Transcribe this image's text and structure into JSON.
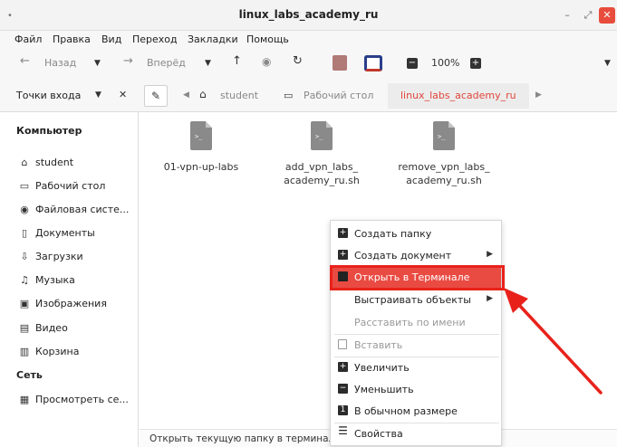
{
  "window": {
    "title": "linux_labs_academy_ru",
    "minimize": "–",
    "maximize": "⤢",
    "close": "✕"
  },
  "menubar": [
    "Файл",
    "Правка",
    "Вид",
    "Переход",
    "Закладки",
    "Помощь"
  ],
  "toolbar": {
    "back": "Назад",
    "forward": "Вперёд",
    "zoom": "100%"
  },
  "location": {
    "places_label": "Точки входа",
    "crumbs": [
      "student",
      "Рабочий стол"
    ],
    "active_crumb": "linux_labs_academy_ru"
  },
  "sidebar": {
    "computer_header": "Компьютер",
    "computer_items": [
      "student",
      "Рабочий стол",
      "Файловая систе...",
      "Документы",
      "Загрузки",
      "Музыка",
      "Изображения",
      "Видео",
      "Корзина"
    ],
    "network_header": "Сеть",
    "network_items": [
      "Просмотреть се..."
    ]
  },
  "files": [
    {
      "name_line1": "01-vpn-up-labs",
      "name_line2": "",
      "icon": "script-file-icon"
    },
    {
      "name_line1": "add_vpn_labs_",
      "name_line2": "academy_ru.sh",
      "icon": "script-file-icon"
    },
    {
      "name_line1": "remove_vpn_labs_",
      "name_line2": "academy_ru.sh",
      "icon": "script-file-icon"
    }
  ],
  "file_icon_glyph": ">_",
  "context_menu": {
    "create_folder": "Создать папку",
    "create_document": "Создать документ",
    "open_terminal": "Открыть в Терминале",
    "arrange_items": "Выстраивать объекты",
    "sort_by_name": "Расставить по имени",
    "paste": "Вставить",
    "zoom_in": "Увеличить",
    "zoom_out": "Уменьшить",
    "normal_size": "В обычном размере",
    "properties": "Свойства"
  },
  "statusbar": {
    "text": "Открыть текущую папку в терминале"
  },
  "colors": {
    "accent": "#e94b43",
    "highlight_border": "#e8221b",
    "arrow": "#e8221b"
  }
}
